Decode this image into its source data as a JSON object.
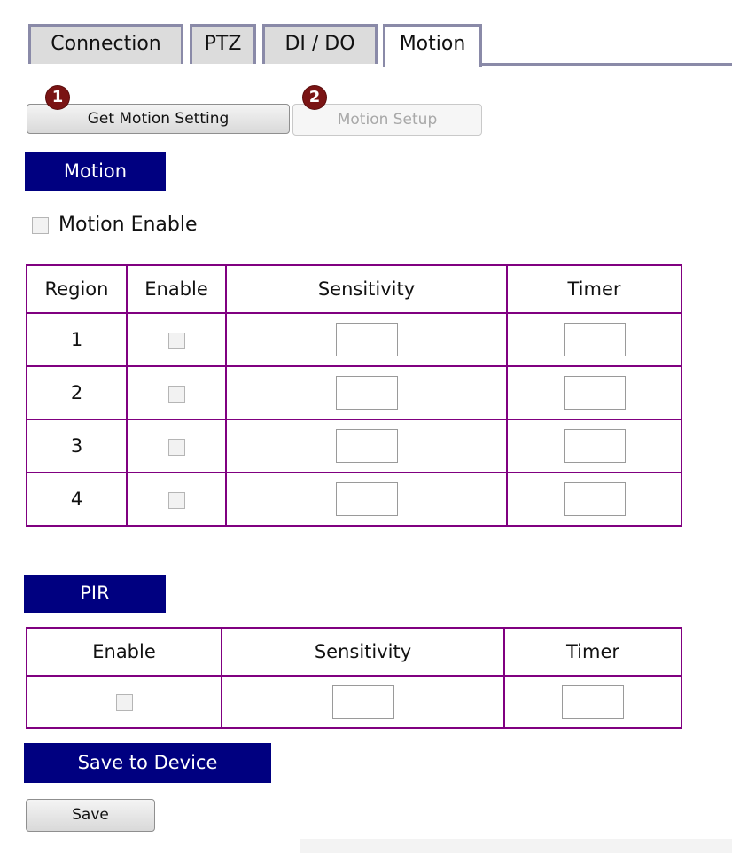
{
  "tabs": [
    {
      "label": "Connection",
      "active": false
    },
    {
      "label": "PTZ",
      "active": false
    },
    {
      "label": "DI / DO",
      "active": false
    },
    {
      "label": "Motion",
      "active": true
    }
  ],
  "actions": {
    "get_motion_setting": {
      "label": "Get Motion Setting",
      "step": "1"
    },
    "motion_setup": {
      "label": "Motion Setup",
      "step": "2",
      "disabled": true
    }
  },
  "motion_section": {
    "header": "Motion",
    "enable_label": "Motion Enable",
    "table": {
      "headers": [
        "Region",
        "Enable",
        "Sensitivity",
        "Timer"
      ],
      "rows": [
        {
          "region": "1",
          "enabled": false,
          "sensitivity": "",
          "timer": ""
        },
        {
          "region": "2",
          "enabled": false,
          "sensitivity": "",
          "timer": ""
        },
        {
          "region": "3",
          "enabled": false,
          "sensitivity": "",
          "timer": ""
        },
        {
          "region": "4",
          "enabled": false,
          "sensitivity": "",
          "timer": ""
        }
      ]
    }
  },
  "pir_section": {
    "header": "PIR",
    "table": {
      "headers": [
        "Enable",
        "Sensitivity",
        "Timer"
      ],
      "row": {
        "enabled": false,
        "sensitivity": "",
        "timer": ""
      }
    }
  },
  "save_section": {
    "header": "Save to Device",
    "save_label": "Save"
  },
  "colors": {
    "section_header_bg": "#000080",
    "table_border": "#800080",
    "tab_border": "#8a8aa8",
    "badge": "#7a1414"
  }
}
